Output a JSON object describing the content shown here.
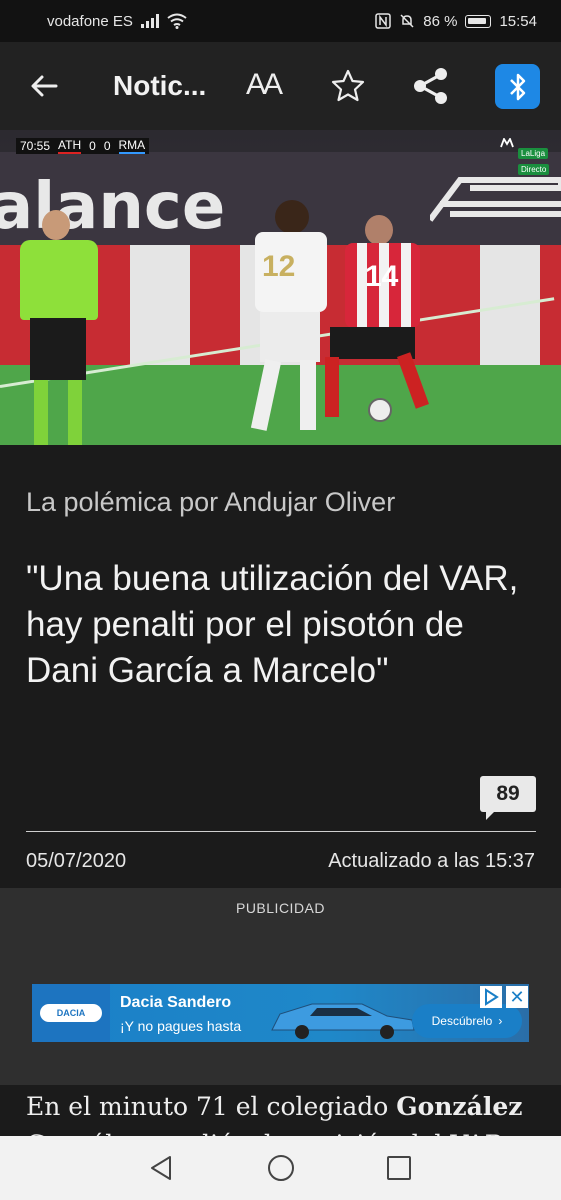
{
  "status_bar": {
    "carrier": "vodafone ES",
    "battery_percent": "86 %",
    "time": "15:54",
    "icons": [
      "signal-icon",
      "wifi-icon",
      "nfc-icon",
      "mute-icon",
      "battery-icon"
    ]
  },
  "toolbar": {
    "title": "Notic...",
    "font_size_label": "AA",
    "icons": [
      "back-arrow-icon",
      "font-size-icon",
      "star-icon",
      "share-icon",
      "bluetooth-icon"
    ],
    "accent_color": "#1e88e5"
  },
  "hero": {
    "scoreboard": {
      "clock": "70:55",
      "home_team": "ATH",
      "home_score": "0",
      "away_score": "0",
      "away_team": "RMA"
    },
    "broadcast": {
      "live_label": "LaLiga",
      "direct_label": "Directo"
    },
    "ad_board_text": "alance",
    "player_numbers": [
      "12",
      "14"
    ]
  },
  "article": {
    "section": "La polémica por Andujar Oliver",
    "headline": "\"Una buena utilización del VAR, hay penalti por el pisotón de Dani García a Marcelo\"",
    "comments_count": "89",
    "date": "05/07/2020",
    "updated": "Actualizado a las 15:37",
    "body_start": "En el minuto 71 el colegiado ",
    "body_bold": "González",
    "body_line2": "González acudió a la revisión del VAR..."
  },
  "ad": {
    "label": "PUBLICIDAD",
    "brand": "DACIA",
    "title": "Dacia Sandero",
    "subtitle": "¡Y no pagues hasta",
    "cta": "Descúbrelo",
    "colors": {
      "brand_blue": "#1d74c0"
    }
  },
  "nav_bar": {
    "icons": [
      "nav-back-icon",
      "nav-home-icon",
      "nav-recents-icon"
    ]
  }
}
